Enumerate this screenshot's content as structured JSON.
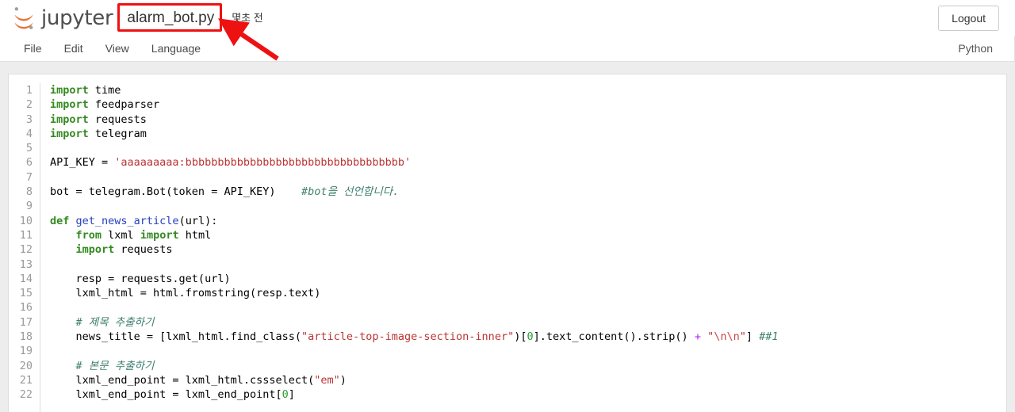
{
  "header": {
    "brand": "jupyter",
    "logo_icon": "jupyter-logo-icon",
    "filename": "alarm_bot.py",
    "saved_time": "몇초 전",
    "logout_label": "Logout"
  },
  "menubar": {
    "items": [
      {
        "label": "File"
      },
      {
        "label": "Edit"
      },
      {
        "label": "View"
      },
      {
        "label": "Language"
      }
    ],
    "kernel": "Python"
  },
  "annotation": {
    "highlight_color": "#ee1111",
    "target": "alarm_bot.py",
    "arrow_icon": "arrow-up-left-icon"
  },
  "editor": {
    "line_numbers": [
      1,
      2,
      3,
      4,
      5,
      6,
      7,
      8,
      9,
      10,
      11,
      12,
      13,
      14,
      15,
      16,
      17,
      18,
      19,
      20,
      21,
      22
    ],
    "lines": [
      {
        "n": 1,
        "tokens": [
          {
            "t": "import",
            "c": "kw"
          },
          {
            "t": " time",
            "c": ""
          }
        ]
      },
      {
        "n": 2,
        "tokens": [
          {
            "t": "import",
            "c": "kw"
          },
          {
            "t": " feedparser",
            "c": ""
          }
        ]
      },
      {
        "n": 3,
        "tokens": [
          {
            "t": "import",
            "c": "kw"
          },
          {
            "t": " requests",
            "c": ""
          }
        ]
      },
      {
        "n": 4,
        "tokens": [
          {
            "t": "import",
            "c": "kw"
          },
          {
            "t": " telegram",
            "c": ""
          }
        ]
      },
      {
        "n": 5,
        "tokens": []
      },
      {
        "n": 6,
        "tokens": [
          {
            "t": "API_KEY = ",
            "c": ""
          },
          {
            "t": "'aaaaaaaaa:bbbbbbbbbbbbbbbbbbbbbbbbbbbbbbbbbb'",
            "c": "str"
          }
        ]
      },
      {
        "n": 7,
        "tokens": []
      },
      {
        "n": 8,
        "tokens": [
          {
            "t": "bot = telegram.Bot(token = API_KEY)    ",
            "c": ""
          },
          {
            "t": "#bot을 선언합니다.",
            "c": "cmt"
          }
        ]
      },
      {
        "n": 9,
        "tokens": []
      },
      {
        "n": 10,
        "tokens": [
          {
            "t": "def ",
            "c": "kw"
          },
          {
            "t": "get_news_article",
            "c": "def"
          },
          {
            "t": "(url):",
            "c": ""
          }
        ]
      },
      {
        "n": 11,
        "tokens": [
          {
            "t": "    ",
            "c": ""
          },
          {
            "t": "from",
            "c": "kw"
          },
          {
            "t": " lxml ",
            "c": ""
          },
          {
            "t": "import",
            "c": "kw"
          },
          {
            "t": " html",
            "c": ""
          }
        ]
      },
      {
        "n": 12,
        "tokens": [
          {
            "t": "    ",
            "c": ""
          },
          {
            "t": "import",
            "c": "kw"
          },
          {
            "t": " requests",
            "c": ""
          }
        ]
      },
      {
        "n": 13,
        "tokens": []
      },
      {
        "n": 14,
        "tokens": [
          {
            "t": "    resp = requests.get(url)",
            "c": ""
          }
        ]
      },
      {
        "n": 15,
        "tokens": [
          {
            "t": "    lxml_html = html.fromstring(resp.text)",
            "c": ""
          }
        ]
      },
      {
        "n": 16,
        "tokens": []
      },
      {
        "n": 17,
        "tokens": [
          {
            "t": "    ",
            "c": ""
          },
          {
            "t": "# 제목 추출하기",
            "c": "cmt"
          }
        ]
      },
      {
        "n": 18,
        "tokens": [
          {
            "t": "    news_title = [lxml_html.find_class(",
            "c": ""
          },
          {
            "t": "\"article-top-image-section-inner\"",
            "c": "str"
          },
          {
            "t": ")[",
            "c": ""
          },
          {
            "t": "0",
            "c": "num"
          },
          {
            "t": "].text_content().strip() ",
            "c": ""
          },
          {
            "t": "+",
            "c": "op"
          },
          {
            "t": " ",
            "c": ""
          },
          {
            "t": "\"",
            "c": "str"
          },
          {
            "t": "\\n\\n",
            "c": "esc"
          },
          {
            "t": "\"",
            "c": "str"
          },
          {
            "t": "] ",
            "c": ""
          },
          {
            "t": "##1",
            "c": "cmt"
          }
        ]
      },
      {
        "n": 19,
        "tokens": []
      },
      {
        "n": 20,
        "tokens": [
          {
            "t": "    ",
            "c": ""
          },
          {
            "t": "# 본문 추출하기",
            "c": "cmt"
          }
        ]
      },
      {
        "n": 21,
        "tokens": [
          {
            "t": "    lxml_end_point = lxml_html.cssselect(",
            "c": ""
          },
          {
            "t": "\"em\"",
            "c": "str"
          },
          {
            "t": ")",
            "c": ""
          }
        ]
      },
      {
        "n": 22,
        "tokens": [
          {
            "t": "    lxml_end_point = lxml_end_point[",
            "c": ""
          },
          {
            "t": "0",
            "c": "num"
          },
          {
            "t": "]",
            "c": ""
          }
        ]
      }
    ]
  }
}
